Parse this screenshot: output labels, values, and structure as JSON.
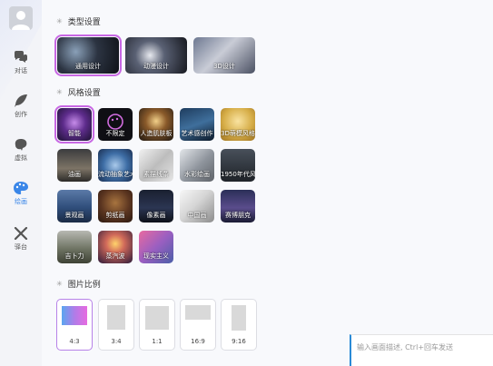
{
  "sidebar": {
    "items": [
      {
        "label": "对话",
        "icon": "chat-bubbles-icon"
      },
      {
        "label": "创作",
        "icon": "feather-icon"
      },
      {
        "label": "虚拟",
        "icon": "brain-icon"
      },
      {
        "label": "绘画",
        "icon": "palette-icon"
      },
      {
        "label": "驿台",
        "icon": "tools-icon"
      }
    ],
    "active": "绘画",
    "accent": "#3a86e8"
  },
  "sections": {
    "type": {
      "title": "类型设置"
    },
    "style": {
      "title": "风格设置"
    },
    "ratio": {
      "title": "图片比例"
    }
  },
  "types": [
    {
      "label": "通用设计",
      "selected": true
    },
    {
      "label": "动漫设计",
      "selected": false
    },
    {
      "label": "3D设计",
      "selected": false
    }
  ],
  "styles": [
    {
      "label": "智能",
      "selected": true
    },
    {
      "label": "不限定",
      "selected": false
    },
    {
      "label": "人造肌肤板",
      "selected": false
    },
    {
      "label": "艺术感创作",
      "selected": false
    },
    {
      "label": "3D萌模风格",
      "selected": false
    },
    {
      "label": "油画",
      "selected": false
    },
    {
      "label": "流动抽象艺术",
      "selected": false
    },
    {
      "label": "素描线条",
      "selected": false
    },
    {
      "label": "水彩绘画",
      "selected": false
    },
    {
      "label": "1950年代风格",
      "selected": false
    },
    {
      "label": "景观画",
      "selected": false
    },
    {
      "label": "剪纸画",
      "selected": false
    },
    {
      "label": "像素画",
      "selected": false
    },
    {
      "label": "中国画",
      "selected": false
    },
    {
      "label": "赛博朋克",
      "selected": false
    },
    {
      "label": "吉卜力",
      "selected": false
    },
    {
      "label": "蒸汽波",
      "selected": false
    },
    {
      "label": "现实主义",
      "selected": false
    }
  ],
  "ratios": [
    {
      "label": "4:3",
      "selected": true
    },
    {
      "label": "3:4",
      "selected": false
    },
    {
      "label": "1:1",
      "selected": false
    },
    {
      "label": "16:9",
      "selected": false
    },
    {
      "label": "9:16",
      "selected": false
    }
  ],
  "prompt": {
    "value": "",
    "placeholder": "输入画面描述, Ctrl+回车发送"
  },
  "colors": {
    "selection_outline": "#c868e4",
    "ratio_gradient_start": "#5aa6f0",
    "ratio_gradient_end": "#e76be0"
  }
}
